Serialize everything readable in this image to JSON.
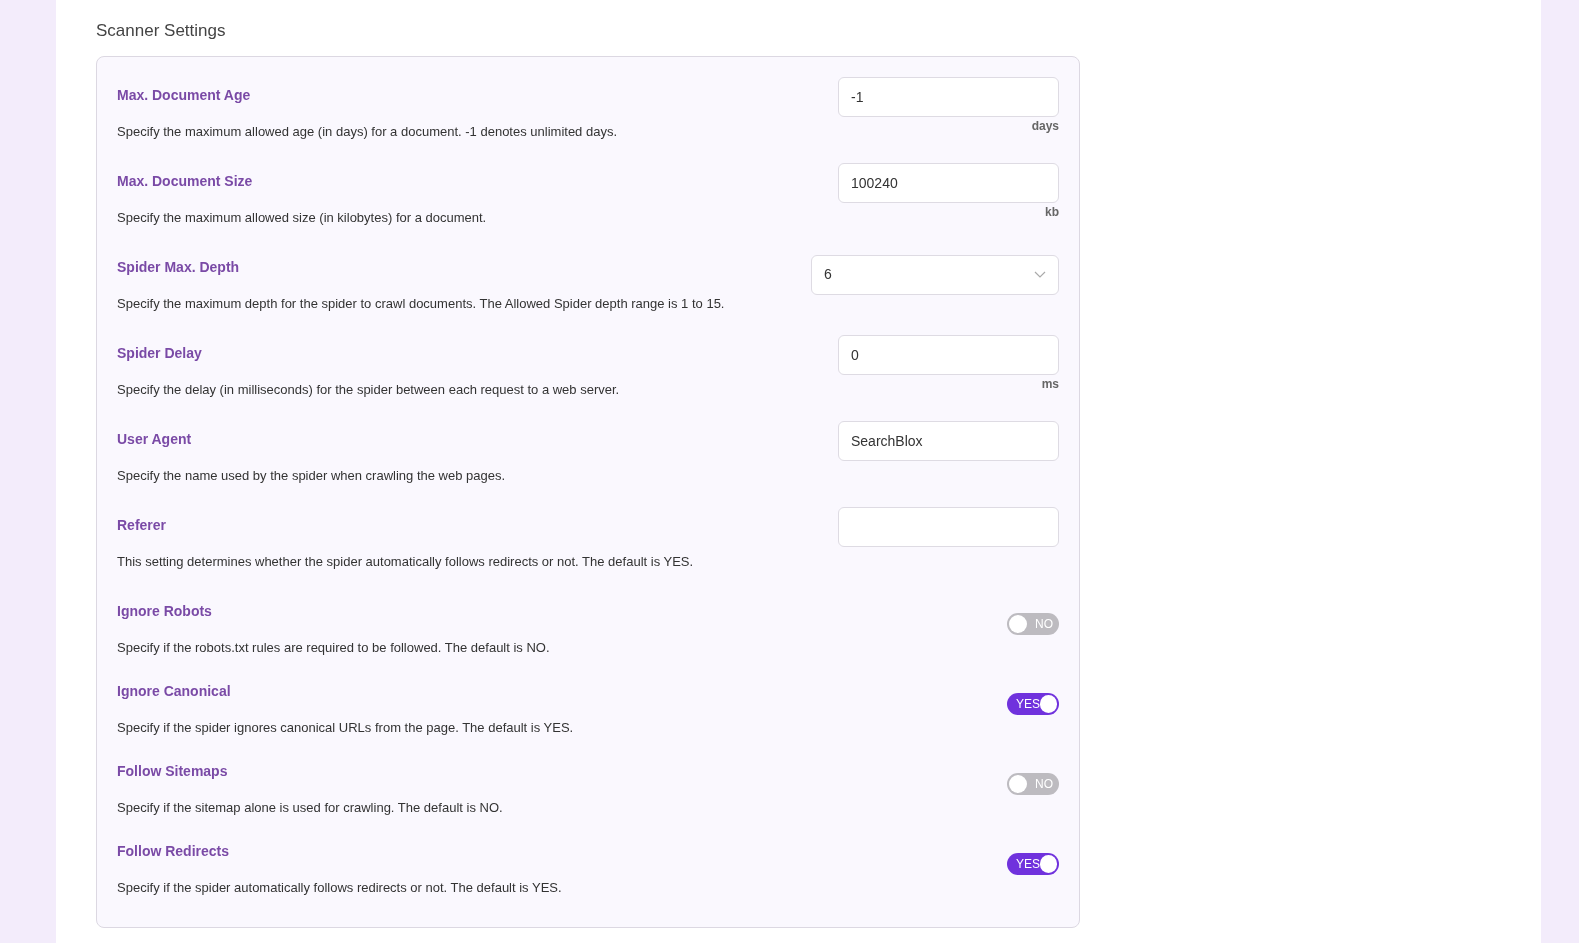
{
  "section_title": "Scanner Settings",
  "settings": [
    {
      "kind": "input",
      "label": "Max. Document Age",
      "description": "Specify the maximum allowed age (in days) for a document. -1 denotes unlimited days.",
      "value": "-1",
      "unit": "days"
    },
    {
      "kind": "input",
      "label": "Max. Document Size",
      "description": "Specify the maximum allowed size (in kilobytes) for a document.",
      "value": "100240",
      "unit": "kb"
    },
    {
      "kind": "select",
      "label": "Spider Max. Depth",
      "description": "Specify the maximum depth for the spider to crawl documents. The Allowed Spider depth range is 1 to 15.",
      "value": "6"
    },
    {
      "kind": "input",
      "label": "Spider Delay",
      "description": "Specify the delay (in milliseconds) for the spider between each request to a web server.",
      "value": "0",
      "unit": "ms"
    },
    {
      "kind": "input",
      "label": "User Agent",
      "description": "Specify the name used by the spider when crawling the web pages.",
      "value": "SearchBlox"
    },
    {
      "kind": "input",
      "label": "Referer",
      "description": "This setting determines whether the spider automatically follows redirects or not. The default is YES."
    },
    {
      "kind": "toggle",
      "label": "Ignore Robots",
      "description": "Specify if the robots.txt rules are required to be followed. The default is NO.",
      "on": false,
      "state_text": "NO"
    },
    {
      "kind": "toggle",
      "label": "Ignore Canonical",
      "description": "Specify if the spider ignores canonical URLs from the page. The default is YES.",
      "on": true,
      "state_text": "YES"
    },
    {
      "kind": "toggle",
      "label": "Follow Sitemaps",
      "description": "Specify if the sitemap alone is used for crawling. The default is NO.",
      "on": false,
      "state_text": "NO"
    },
    {
      "kind": "toggle",
      "label": "Follow Redirects",
      "description": "Specify if the spider automatically follows redirects or not. The default is YES.",
      "on": true,
      "state_text": "YES"
    }
  ]
}
